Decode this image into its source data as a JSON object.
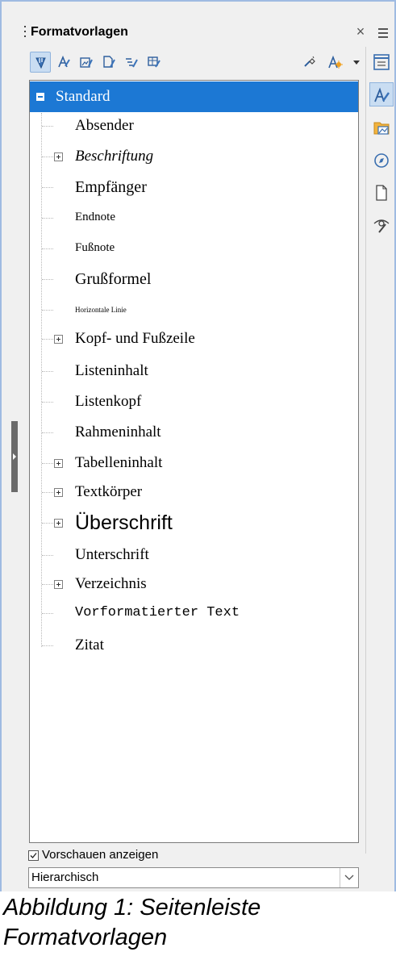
{
  "panel": {
    "title": "Formatvorlagen",
    "close_glyph": "×"
  },
  "toolbar": {
    "buttons": [
      {
        "icon": "paragraph-styles-icon",
        "active": true
      },
      {
        "icon": "character-styles-icon"
      },
      {
        "icon": "frame-styles-icon"
      },
      {
        "icon": "page-styles-icon"
      },
      {
        "icon": "list-styles-icon"
      },
      {
        "icon": "table-styles-icon"
      },
      {
        "icon": "fill-format-mode-icon"
      },
      {
        "icon": "new-style-from-selection-icon"
      }
    ]
  },
  "styles": [
    {
      "label": "Standard",
      "selected": true
    },
    {
      "label": "Absender",
      "font_size": 19
    },
    {
      "label": "Beschriftung",
      "font_size": 19,
      "italic": true,
      "expandable": true
    },
    {
      "label": "Empfänger",
      "font_size": 20
    },
    {
      "label": "Endnote",
      "font_size": 15
    },
    {
      "label": "Fußnote",
      "font_size": 15
    },
    {
      "label": "Grußformel",
      "font_size": 20
    },
    {
      "label": "Horizontale Linie",
      "font_size": 9
    },
    {
      "label": "Kopf- und Fußzeile",
      "font_size": 19,
      "expandable": true
    },
    {
      "label": "Listeninhalt",
      "font_size": 19
    },
    {
      "label": "Listenkopf",
      "font_size": 19
    },
    {
      "label": "Rahmeninhalt",
      "font_size": 19
    },
    {
      "label": "Tabelleninhalt",
      "font_size": 19,
      "expandable": true
    },
    {
      "label": "Textkörper",
      "font_size": 19,
      "expandable": true
    },
    {
      "label": "Überschrift",
      "font_size": 25,
      "sans": true,
      "expandable": true
    },
    {
      "label": "Unterschrift",
      "font_size": 19
    },
    {
      "label": "Verzeichnis",
      "font_size": 19,
      "expandable": true
    },
    {
      "label": "Vorformatierter Text",
      "font_size": 17,
      "mono": true
    },
    {
      "label": "Zitat",
      "font_size": 19
    }
  ],
  "footer": {
    "preview_label": "Vorschauen anzeigen",
    "preview_checked": true,
    "filter_value": "Hierarchisch"
  },
  "deck": {
    "buttons": [
      {
        "icon": "properties-icon"
      },
      {
        "icon": "styles-icon",
        "active": true
      },
      {
        "icon": "gallery-icon"
      },
      {
        "icon": "navigator-icon"
      },
      {
        "icon": "page-icon"
      },
      {
        "icon": "style-inspector-icon"
      }
    ]
  },
  "caption": {
    "line1": "Abbildung 1: Seitenleiste",
    "line2": "Formatvorlagen"
  },
  "colors": {
    "selection": "#1c78d4",
    "active_button": "#c9ddf2",
    "frame_border": "#9fbbe2"
  }
}
